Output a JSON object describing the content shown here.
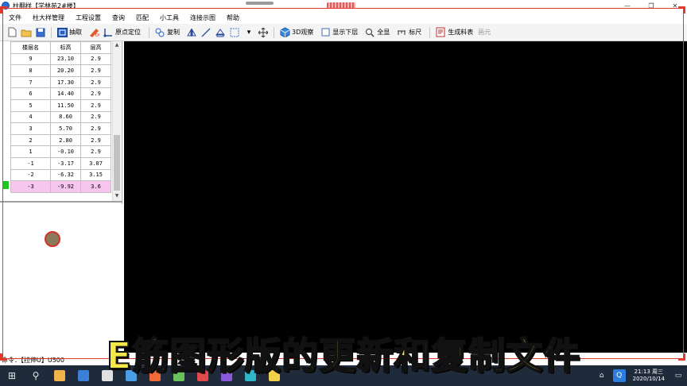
{
  "window": {
    "title": "柱翻样【学林苑2#楼】",
    "controls": [
      "—",
      "❐",
      "✕"
    ]
  },
  "menu": [
    "文件",
    "柱大样管理",
    "工程设置",
    "查询",
    "匹配",
    "小工具",
    "连接示图",
    "帮助"
  ],
  "toolbar": {
    "extract": "抽取",
    "origin": "原点定位",
    "copy": "复制",
    "view3d": "3D观察",
    "show_lower": "显示下层",
    "show_all": "全显",
    "ruler": "标尺",
    "gen_table": "生成料表",
    "draw": "画元"
  },
  "floor_table": {
    "headers": [
      "楼层名",
      "标高",
      "层高"
    ],
    "rows": [
      [
        "9",
        "23.10",
        "2.9"
      ],
      [
        "8",
        "20.20",
        "2.9"
      ],
      [
        "7",
        "17.30",
        "2.9"
      ],
      [
        "6",
        "14.40",
        "2.9"
      ],
      [
        "5",
        "11.50",
        "2.9"
      ],
      [
        "4",
        "8.60",
        "2.9"
      ],
      [
        "3",
        "5.70",
        "2.9"
      ],
      [
        "2",
        "2.80",
        "2.9"
      ],
      [
        "1",
        "-0.10",
        "2.9"
      ],
      [
        "-1",
        "-3.17",
        "3.07"
      ],
      [
        "-2",
        "-6.32",
        "3.15"
      ],
      [
        "-3",
        "-9.92",
        "3.6"
      ]
    ],
    "selected_row": 11,
    "scroll_arrows": [
      "▲",
      "▼"
    ]
  },
  "command_line": "命令：【拉伸U】U500",
  "caption": "E筋图形版的更新和复制文件",
  "taskbar": {
    "start": "⊞",
    "search": "⚲",
    "tray_q": "Q",
    "time": "21:13 周三",
    "date": "2020/10/14",
    "app_colors": [
      "#f3b24a",
      "#3b7fd8",
      "#e0e0e0",
      "#4a9ee8",
      "#f06a3a",
      "#6ac25a",
      "#e04a4a",
      "#8a5ad8",
      "#2fb6c8",
      "#f3d04a"
    ]
  },
  "colors": {
    "canvas": "#000000",
    "selected_row": "#f6c6ee",
    "row_marker": "#22c322",
    "rec_frame": "#e03a2a",
    "caption": "#f7e84a"
  }
}
